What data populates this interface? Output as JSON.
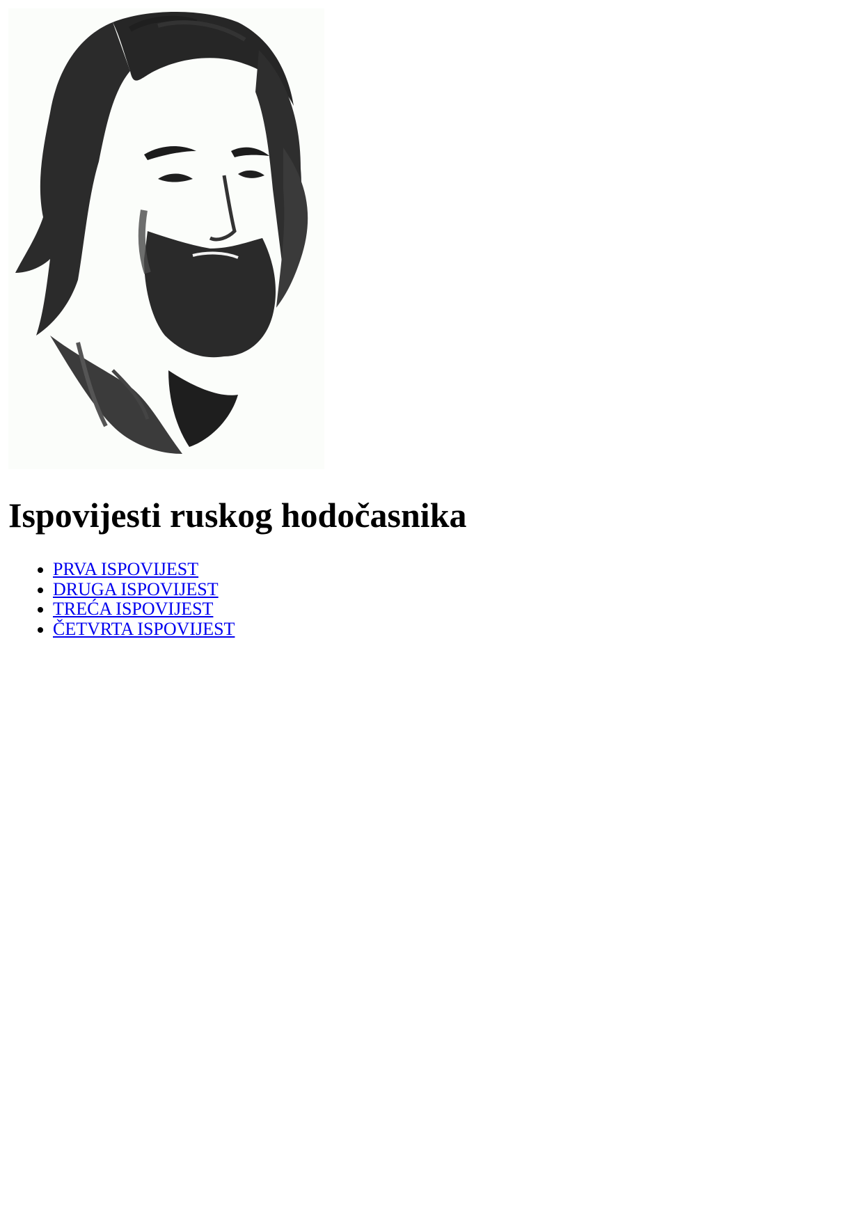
{
  "page": {
    "title": "Ispovijesti ruskog hodočasnika",
    "link_color": "#0000ee",
    "text_color": "#000000",
    "background": "#ffffff"
  },
  "portrait": {
    "description_icon": "portrait-sketch",
    "ink_color": "#2b2b2b",
    "paper_color": "#fbfdfa"
  },
  "chapters": [
    {
      "label": "PRVA ISPOVIJEST"
    },
    {
      "label": "DRUGA ISPOVIJEST"
    },
    {
      "label": "TREĆA ISPOVIJEST"
    },
    {
      "label": "ČETVRTA ISPOVIJEST"
    }
  ]
}
